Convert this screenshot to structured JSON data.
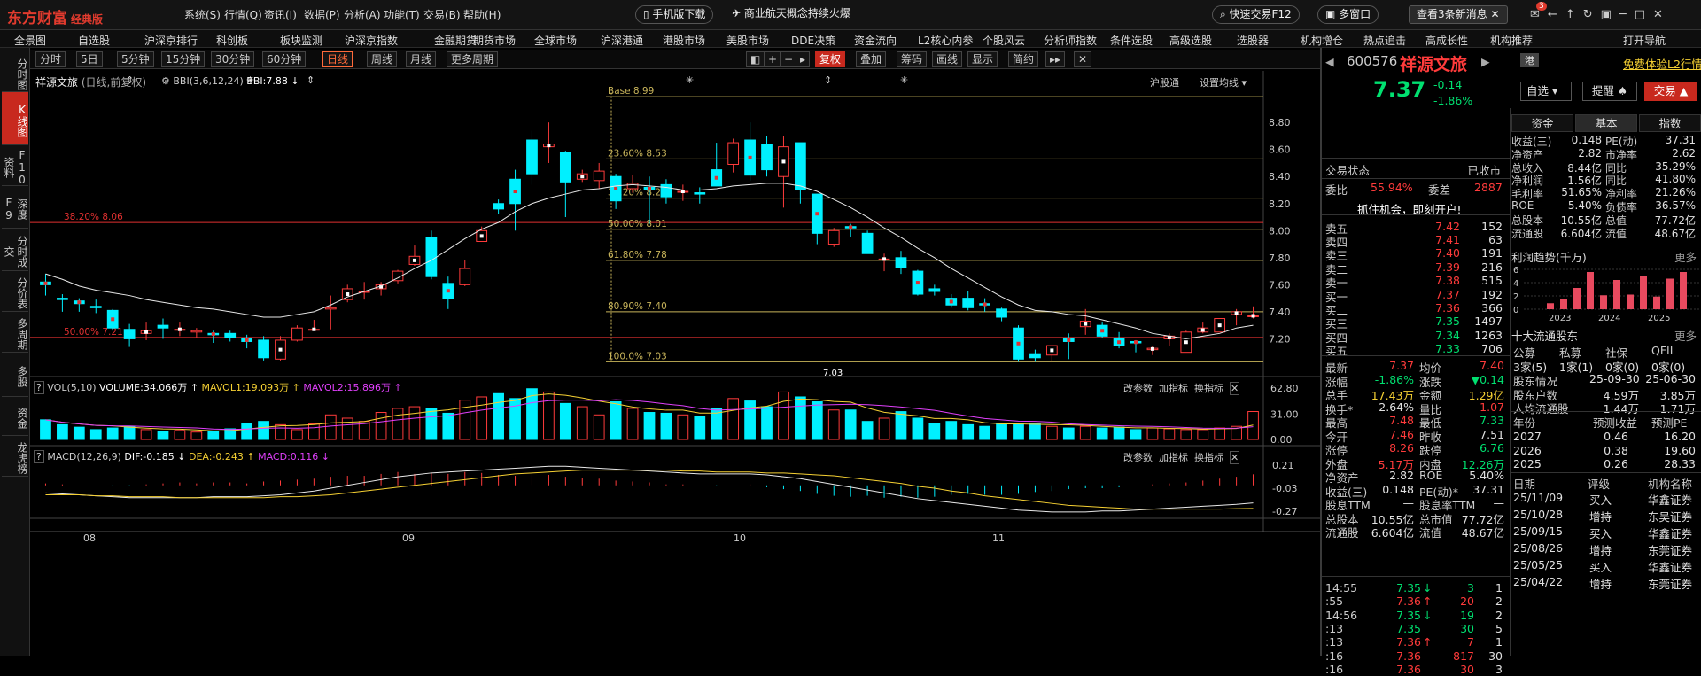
{
  "app": {
    "logo": "东方财富",
    "edition": "经典版"
  },
  "top_menu": [
    "系统(S)",
    "行情(Q)",
    "资讯(I)",
    "数据(P)",
    "分析(A)",
    "功能(T)",
    "交易(B)",
    "帮助(H)"
  ],
  "promo": {
    "mobile": "手机版下载",
    "news": "商业航天概念持续火爆",
    "quick_trade": "快速交易F12",
    "multi_screen": "多窗口",
    "messages": "查看3条新消息",
    "badge": "3"
  },
  "nav": [
    "全景图",
    "自选股",
    "沪深京排行",
    "科创板",
    "板块监测",
    "沪深京指数",
    "金融期货",
    "期货市场",
    "全球市场",
    "沪深港通",
    "港股市场",
    "美股市场",
    "DDE决策",
    "资金流向",
    "L2核心内参",
    "个股风云",
    "分析师指数",
    "条件选股",
    "高级选股",
    "选股器",
    "机构增仓",
    "热点追击",
    "高成长性",
    "机构推荐",
    "打开导航"
  ],
  "left_tabs": [
    "分时图",
    "K线图",
    "F10资料",
    "深度F9",
    "分时成交",
    "分价表",
    "多周期",
    "多股",
    "资金",
    "龙虎榜"
  ],
  "toolbar": {
    "periods": [
      "分时",
      "5日",
      "5分钟",
      "15分钟",
      "30分钟",
      "60分钟",
      "日线",
      "周线",
      "月线",
      "更多周期"
    ],
    "active": "日线",
    "fq": "复权",
    "overlay": "叠加",
    "chips": "筹码",
    "draw": "画线",
    "display": "显示",
    "brief": "简约",
    "index": "沪股通",
    "ma_set": "设置均线"
  },
  "main": {
    "name": "祥源文旅",
    "mode": "(日线,前复权)",
    "bbi_title": "BBI(3,6,12,24)",
    "bbi_value": "BBI:7.88"
  },
  "price_axis": [
    "8.80",
    "8.60",
    "8.40",
    "8.20",
    "8.00",
    "7.80",
    "7.60",
    "7.40",
    "7.20"
  ],
  "fib": [
    {
      "label": "38.20% 8.06",
      "v": 8.06,
      "c": "#e03030"
    },
    {
      "label": "50.00% 7.21",
      "v": 7.21,
      "c": "#e03030"
    },
    {
      "label": "23.60% 8.53",
      "v": 8.53,
      "c": "#c8b45a"
    },
    {
      "label": "38.20% 8.24",
      "v": 8.24,
      "c": "#c8b45a"
    },
    {
      "label": "50.00% 8.01",
      "v": 8.01,
      "c": "#c8b45a"
    },
    {
      "label": "61.80% 7.78",
      "v": 7.78,
      "c": "#c8b45a"
    },
    {
      "label": "80.90% 7.40",
      "v": 7.4,
      "c": "#c8b45a"
    },
    {
      "label": "100.0% 7.03",
      "v": 7.03,
      "c": "#c8b45a"
    },
    {
      "label": "Base 8.99",
      "v": 8.99,
      "c": "#c8b45a"
    }
  ],
  "low_label": "7.03",
  "vol": {
    "title": "VOL(5,10)",
    "volume": "VOLUME:34.066万",
    "ma1": "MAVOL1:19.093万",
    "ma2": "MAVOL2:15.896万",
    "axis": [
      "62.80",
      "31.00",
      "0.00"
    ]
  },
  "macd": {
    "title": "MACD(12,26,9)",
    "dif": "DIF:-0.185",
    "dea": "DEA:-0.243",
    "macd": "MACD:0.116",
    "axis": [
      "0.21",
      "-0.03",
      "-0.27"
    ]
  },
  "panel_btns": {
    "params": "改参数",
    "add": "加指标",
    "swap": "换指标"
  },
  "months": [
    "08",
    "09",
    "10",
    "11"
  ],
  "stock": {
    "code": "600576",
    "name": "祥源文旅",
    "hk": "港",
    "l2": "免费体验L2行情",
    "price": "7.37",
    "chg": "-0.14",
    "pct": "-1.86%",
    "watch": "自选",
    "alert": "提醒",
    "trade": "交易"
  },
  "status": {
    "label": "交易状态",
    "value": "已收市"
  },
  "ratio": {
    "wb_label": "委比",
    "wb": "55.94%",
    "wc_label": "委差",
    "wc": "2887"
  },
  "open_account": "抓住机会，即刻开户!",
  "asks": [
    {
      "n": "卖五",
      "p": "7.42",
      "v": "152"
    },
    {
      "n": "卖四",
      "p": "7.41",
      "v": "63"
    },
    {
      "n": "卖三",
      "p": "7.40",
      "v": "191"
    },
    {
      "n": "卖二",
      "p": "7.39",
      "v": "216"
    },
    {
      "n": "卖一",
      "p": "7.38",
      "v": "515"
    }
  ],
  "bids": [
    {
      "n": "买一",
      "p": "7.37",
      "v": "192"
    },
    {
      "n": "买二",
      "p": "7.36",
      "v": "366"
    },
    {
      "n": "买三",
      "p": "7.35",
      "v": "1497"
    },
    {
      "n": "买四",
      "p": "7.34",
      "v": "1263"
    },
    {
      "n": "买五",
      "p": "7.33",
      "v": "706"
    }
  ],
  "quote": [
    {
      "a": "最新",
      "av": "7.37",
      "ac": "red",
      "b": "均价",
      "bv": "7.40",
      "bc": "red"
    },
    {
      "a": "涨幅",
      "av": "-1.86%",
      "ac": "green",
      "b": "涨跌",
      "bv": "▼0.14",
      "bc": "green"
    },
    {
      "a": "总手",
      "av": "17.43万",
      "ac": "yel",
      "b": "金额",
      "bv": "1.29亿",
      "bc": "yel"
    },
    {
      "a": "换手*",
      "av": "2.64%",
      "ac": "wht",
      "b": "量比",
      "bv": "1.07",
      "bc": "red"
    },
    {
      "a": "最高",
      "av": "7.48",
      "ac": "red",
      "b": "最低",
      "bv": "7.33",
      "bc": "green"
    },
    {
      "a": "今开",
      "av": "7.46",
      "ac": "red",
      "b": "昨收",
      "bv": "7.51",
      "bc": "wht"
    },
    {
      "a": "涨停",
      "av": "8.26",
      "ac": "red",
      "b": "跌停",
      "bv": "6.76",
      "bc": "green"
    },
    {
      "a": "外盘",
      "av": "5.17万",
      "ac": "red",
      "b": "内盘",
      "bv": "12.26万",
      "bc": "green"
    },
    {
      "a": "净资产",
      "av": "2.82",
      "ac": "wht",
      "b": "ROE",
      "bv": "5.40%",
      "bc": "wht"
    },
    {
      "a": "收益(三)",
      "av": "0.148",
      "ac": "wht",
      "b": "PE(动)*",
      "bv": "37.31",
      "bc": "wht"
    },
    {
      "a": "股息TTM",
      "av": "—",
      "ac": "wht",
      "b": "股息率TTM",
      "bv": "—",
      "bc": "wht"
    },
    {
      "a": "总股本",
      "av": "10.55亿",
      "ac": "wht",
      "b": "总市值",
      "bv": "77.72亿",
      "bc": "wht"
    },
    {
      "a": "流通股",
      "av": "6.604亿",
      "ac": "wht",
      "b": "流值",
      "bv": "48.67亿",
      "bc": "wht"
    }
  ],
  "ticks": [
    {
      "t": "14:55",
      "p": "7.35",
      "pc": "green",
      "ar": "↓",
      "v": "3",
      "n": "1"
    },
    {
      "t": ":55",
      "p": "7.36",
      "pc": "red",
      "ar": "↑",
      "v": "20",
      "n": "2"
    },
    {
      "t": "14:56",
      "p": "7.35",
      "pc": "green",
      "ar": "↓",
      "v": "19",
      "n": "2"
    },
    {
      "t": ":13",
      "p": "7.35",
      "pc": "green",
      "ar": "",
      "v": "30",
      "n": "5"
    },
    {
      "t": ":13",
      "p": "7.36",
      "pc": "red",
      "ar": "↑",
      "v": "7",
      "n": "1"
    },
    {
      "t": ":16",
      "p": "7.36",
      "pc": "red",
      "ar": "",
      "v": "817",
      "n": "30"
    },
    {
      "t": ":16",
      "p": "7.36",
      "pc": "red",
      "ar": "",
      "v": "30",
      "n": "3"
    }
  ],
  "tabs3": [
    "资金",
    "基本",
    "指数"
  ],
  "basic": [
    {
      "a": "收益(三)",
      "av": "0.148",
      "b": "PE(动)",
      "bv": "37.31"
    },
    {
      "a": "净资产",
      "av": "2.82",
      "b": "市净率",
      "bv": "2.62"
    },
    {
      "a": "总收入",
      "av": "8.44亿",
      "b": "同比",
      "bv": "35.29%"
    },
    {
      "a": "净利润",
      "av": "1.56亿",
      "b": "同比",
      "bv": "41.80%"
    },
    {
      "a": "毛利率",
      "av": "51.65%",
      "b": "净利率",
      "bv": "21.26%"
    },
    {
      "a": "ROE",
      "av": "5.40%",
      "b": "负债率",
      "bv": "36.57%"
    },
    {
      "a": "总股本",
      "av": "10.55亿",
      "b": "总值",
      "bv": "77.72亿"
    },
    {
      "a": "流通股",
      "av": "6.604亿",
      "b": "流值",
      "bv": "48.67亿"
    }
  ],
  "profit": {
    "title": "利润趋势(千万)",
    "more": "更多",
    "yaxis": [
      "6",
      "4",
      "2",
      "0"
    ],
    "years": [
      "2023",
      "2024",
      "2025"
    ],
    "bars": [
      0.9,
      1.6,
      3.2,
      5.6,
      2.1,
      4.4,
      2.2,
      5.0,
      1.9,
      4.6,
      5.6
    ]
  },
  "holders": {
    "title": "十大流通股东",
    "more": "更多",
    "cols": [
      "公募",
      "私募",
      "社保",
      "QFII"
    ],
    "vals": [
      "3家(5)",
      "1家(1)",
      "0家(0)",
      "0家(0)"
    ],
    "rows": [
      {
        "a": "股东情况",
        "b": "25-09-30",
        "c": "25-06-30"
      },
      {
        "a": "股东户数",
        "b": "4.59万",
        "c": "3.85万"
      },
      {
        "a": "人均流通股",
        "b": "1.44万",
        "c": "1.71万"
      }
    ]
  },
  "forecast": {
    "cols": [
      "年份",
      "预测收益",
      "预测PE"
    ],
    "rows": [
      {
        "y": "2027",
        "e": "0.46",
        "pe": "16.20"
      },
      {
        "y": "2026",
        "e": "0.38",
        "pe": "19.60"
      },
      {
        "y": "2025",
        "e": "0.26",
        "pe": "28.33"
      }
    ]
  },
  "ratings": {
    "cols": [
      "日期",
      "评级",
      "机构名称"
    ],
    "rows": [
      {
        "d": "25/11/09",
        "r": "买入",
        "o": "华鑫证券"
      },
      {
        "d": "25/10/28",
        "r": "增持",
        "o": "东吴证券"
      },
      {
        "d": "25/09/15",
        "r": "买入",
        "o": "华鑫证券"
      },
      {
        "d": "25/08/26",
        "r": "增持",
        "o": "东莞证券"
      },
      {
        "d": "25/05/25",
        "r": "买入",
        "o": "华鑫证券"
      },
      {
        "d": "25/04/22",
        "r": "增持",
        "o": "东莞证券"
      }
    ]
  },
  "chart_data": {
    "type": "candlestick",
    "ylim": [
      6.98,
      9.05
    ],
    "candles": [
      [
        7.62,
        7.6,
        7.68,
        7.52
      ],
      [
        7.5,
        7.49,
        7.53,
        7.4
      ],
      [
        7.48,
        7.46,
        7.5,
        7.4
      ],
      [
        7.44,
        7.43,
        7.49,
        7.39
      ],
      [
        7.41,
        7.28,
        7.42,
        7.26
      ],
      [
        7.27,
        7.2,
        7.31,
        7.14
      ],
      [
        7.24,
        7.26,
        7.32,
        7.19
      ],
      [
        7.3,
        7.28,
        7.35,
        7.2
      ],
      [
        7.27,
        7.27,
        7.32,
        7.22
      ],
      [
        7.25,
        7.26,
        7.28,
        7.21
      ],
      [
        7.24,
        7.23,
        7.26,
        7.17
      ],
      [
        7.24,
        7.21,
        7.26,
        7.18
      ],
      [
        7.2,
        7.18,
        7.23,
        7.13
      ],
      [
        7.19,
        7.06,
        7.22,
        7.04
      ],
      [
        7.05,
        7.19,
        7.22,
        7.04
      ],
      [
        7.19,
        7.28,
        7.3,
        7.18
      ],
      [
        7.27,
        7.27,
        7.34,
        7.26
      ],
      [
        7.42,
        7.43,
        7.52,
        7.27
      ],
      [
        7.49,
        7.57,
        7.6,
        7.47
      ],
      [
        7.55,
        7.55,
        7.62,
        7.49
      ],
      [
        7.57,
        7.6,
        7.62,
        7.52
      ],
      [
        7.63,
        7.7,
        7.71,
        7.61
      ],
      [
        7.75,
        7.81,
        7.89,
        7.74
      ],
      [
        7.95,
        7.66,
        8.0,
        7.64
      ],
      [
        7.61,
        7.5,
        7.66,
        7.42
      ],
      [
        7.6,
        7.72,
        7.78,
        7.59
      ],
      [
        7.92,
        8.0,
        8.03,
        7.92
      ],
      [
        8.2,
        8.16,
        8.23,
        8.12
      ],
      [
        8.38,
        8.2,
        8.45,
        8.0
      ],
      [
        8.67,
        8.42,
        8.74,
        8.34
      ],
      [
        8.62,
        8.64,
        8.8,
        8.5
      ],
      [
        8.58,
        8.36,
        8.59,
        8.1
      ],
      [
        8.38,
        8.42,
        8.45,
        8.36
      ],
      [
        8.37,
        8.44,
        8.5,
        8.31
      ],
      [
        8.4,
        8.22,
        8.42,
        8.16
      ],
      [
        8.31,
        8.35,
        8.41,
        8.28
      ],
      [
        8.32,
        8.3,
        8.4,
        8.05
      ],
      [
        8.34,
        8.25,
        8.38,
        8.2
      ],
      [
        8.29,
        8.29,
        8.34,
        8.22
      ],
      [
        8.28,
        8.27,
        8.32,
        8.2
      ],
      [
        8.45,
        8.33,
        8.65,
        8.33
      ],
      [
        8.49,
        8.65,
        8.68,
        8.43
      ],
      [
        8.67,
        8.41,
        8.8,
        8.37
      ],
      [
        8.64,
        8.45,
        8.7,
        8.4
      ],
      [
        8.4,
        8.62,
        8.7,
        8.17
      ],
      [
        8.65,
        8.3,
        8.63,
        8.2
      ],
      [
        8.27,
        7.98,
        8.26,
        7.9
      ],
      [
        7.9,
        8.0,
        8.02,
        7.88
      ],
      [
        8.03,
        8.02,
        8.05,
        7.95
      ],
      [
        7.98,
        7.83,
        8.0,
        7.85
      ],
      [
        7.79,
        7.79,
        7.83,
        7.7
      ],
      [
        7.8,
        7.73,
        7.85,
        7.68
      ],
      [
        7.7,
        7.53,
        7.71,
        7.52
      ],
      [
        7.57,
        7.55,
        7.6,
        7.52
      ],
      [
        7.5,
        7.45,
        7.53,
        7.43
      ],
      [
        7.5,
        7.43,
        7.55,
        7.41
      ],
      [
        7.46,
        7.45,
        7.5,
        7.4
      ],
      [
        7.42,
        7.36,
        7.43,
        7.33
      ],
      [
        7.28,
        7.05,
        7.3,
        7.03
      ],
      [
        7.09,
        7.06,
        7.12,
        7.03
      ],
      [
        7.08,
        7.15,
        7.15,
        7.03
      ],
      [
        7.2,
        7.18,
        7.24,
        7.05
      ],
      [
        7.29,
        7.33,
        7.42,
        7.23
      ],
      [
        7.3,
        7.22,
        7.32,
        7.21
      ],
      [
        7.2,
        7.15,
        7.25,
        7.13
      ],
      [
        7.18,
        7.17,
        7.19,
        7.1
      ],
      [
        7.12,
        7.13,
        7.15,
        7.08
      ],
      [
        7.2,
        7.22,
        7.24,
        7.15
      ],
      [
        7.1,
        7.25,
        7.26,
        7.1
      ],
      [
        7.25,
        7.28,
        7.32,
        7.24
      ],
      [
        7.25,
        7.35,
        7.33,
        7.25
      ],
      [
        7.38,
        7.4,
        7.42,
        7.3
      ],
      [
        7.37,
        7.37,
        7.44,
        7.35
      ]
    ],
    "bbi": [
      7.68,
      7.64,
      7.59,
      7.56,
      7.54,
      7.52,
      7.49,
      7.47,
      7.45,
      7.43,
      7.42,
      7.4,
      7.38,
      7.36,
      7.36,
      7.38,
      7.4,
      7.45,
      7.51,
      7.55,
      7.59,
      7.65,
      7.72,
      7.78,
      7.86,
      7.94,
      8.01,
      8.06,
      8.14,
      8.2,
      8.24,
      8.27,
      8.3,
      8.31,
      8.33,
      8.34,
      8.33,
      8.32,
      8.3,
      8.3,
      8.31,
      8.33,
      8.34,
      8.35,
      8.35,
      8.33,
      8.29,
      8.23,
      8.17,
      8.1,
      8.02,
      7.95,
      7.87,
      7.8,
      7.72,
      7.65,
      7.58,
      7.51,
      7.45,
      7.41,
      7.4,
      7.38,
      7.37,
      7.34,
      7.31,
      7.28,
      7.24,
      7.22,
      7.2,
      7.22,
      7.24,
      7.28,
      7.3
    ],
    "volume": [
      24,
      18,
      15,
      12,
      14,
      16,
      12,
      10,
      11,
      9,
      10,
      13,
      20,
      22,
      18,
      12,
      19,
      30,
      26,
      22,
      33,
      38,
      40,
      38,
      32,
      48,
      52,
      56,
      50,
      62,
      58,
      44,
      40,
      30,
      46,
      38,
      33,
      32,
      30,
      28,
      38,
      50,
      47,
      40,
      58,
      52,
      46,
      36,
      36,
      22,
      26,
      34,
      26,
      20,
      22,
      18,
      16,
      19,
      20,
      20,
      16,
      14,
      16,
      14,
      15,
      12,
      14,
      13,
      12,
      12,
      14,
      16,
      34.1
    ],
    "vol_ylim": [
      0,
      62.8
    ],
    "macd_bar": [
      0.02,
      0.01,
      0.0,
      0.0,
      -0.01,
      -0.01,
      0.01,
      0.02,
      0.03,
      0.02,
      0.03,
      0.03,
      0.02,
      0.04,
      0.05,
      0.06,
      0.07,
      0.09,
      0.1,
      0.1,
      0.12,
      0.14,
      0.12,
      0.13,
      0.12,
      0.14,
      0.13,
      0.11,
      0.1,
      0.12,
      0.11,
      0.09,
      0.08,
      0.07,
      0.05,
      0.04,
      0.03,
      0.01,
      0.01,
      0.0,
      -0.01,
      0.0,
      0.01,
      -0.02,
      -0.04,
      -0.06,
      -0.09,
      -0.11,
      -0.12,
      -0.11,
      -0.13,
      -0.12,
      -0.13,
      -0.12,
      -0.1,
      -0.09,
      -0.1,
      -0.1,
      -0.09,
      -0.07,
      -0.06,
      -0.04,
      -0.03,
      -0.03,
      -0.02,
      0.0,
      0.01,
      0.02,
      0.03,
      0.05,
      0.07,
      0.09,
      0.116
    ],
    "dif": [
      -0.08,
      -0.09,
      -0.1,
      -0.11,
      -0.12,
      -0.13,
      -0.13,
      -0.13,
      -0.13,
      -0.13,
      -0.12,
      -0.12,
      -0.12,
      -0.11,
      -0.1,
      -0.08,
      -0.06,
      -0.03,
      0.0,
      0.03,
      0.06,
      0.09,
      0.11,
      0.13,
      0.14,
      0.15,
      0.16,
      0.17,
      0.18,
      0.19,
      0.2,
      0.2,
      0.19,
      0.18,
      0.17,
      0.16,
      0.15,
      0.14,
      0.13,
      0.12,
      0.12,
      0.12,
      0.12,
      0.11,
      0.09,
      0.07,
      0.04,
      0.01,
      -0.02,
      -0.05,
      -0.08,
      -0.11,
      -0.14,
      -0.16,
      -0.18,
      -0.2,
      -0.22,
      -0.24,
      -0.26,
      -0.27,
      -0.28,
      -0.28,
      -0.28,
      -0.27,
      -0.27,
      -0.26,
      -0.25,
      -0.24,
      -0.23,
      -0.22,
      -0.21,
      -0.2,
      -0.185
    ],
    "dea": [
      -0.1,
      -0.1,
      -0.1,
      -0.11,
      -0.11,
      -0.12,
      -0.12,
      -0.12,
      -0.13,
      -0.13,
      -0.13,
      -0.13,
      -0.13,
      -0.13,
      -0.12,
      -0.12,
      -0.11,
      -0.1,
      -0.08,
      -0.06,
      -0.04,
      -0.02,
      0.0,
      0.02,
      0.04,
      0.06,
      0.08,
      0.1,
      0.12,
      0.13,
      0.14,
      0.15,
      0.16,
      0.16,
      0.16,
      0.16,
      0.16,
      0.16,
      0.15,
      0.15,
      0.14,
      0.14,
      0.14,
      0.13,
      0.13,
      0.12,
      0.11,
      0.1,
      0.08,
      0.06,
      0.04,
      0.02,
      -0.01,
      -0.03,
      -0.06,
      -0.08,
      -0.11,
      -0.13,
      -0.15,
      -0.17,
      -0.19,
      -0.21,
      -0.22,
      -0.23,
      -0.24,
      -0.25,
      -0.25,
      -0.25,
      -0.25,
      -0.25,
      -0.25,
      -0.245,
      -0.243
    ],
    "macd_ylim": [
      -0.3,
      0.24
    ]
  }
}
